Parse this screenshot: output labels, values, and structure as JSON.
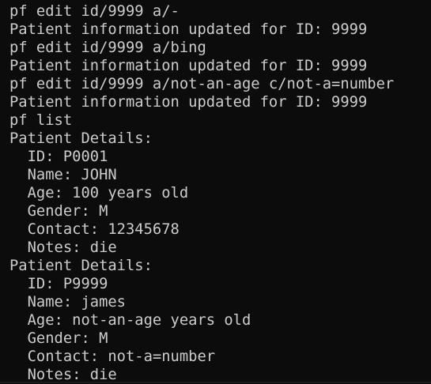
{
  "terminal": {
    "lines": [
      "pf edit id/9999 a/-",
      "Patient information updated for ID: 9999",
      "pf edit id/9999 a/bing",
      "Patient information updated for ID: 9999",
      "pf edit id/9999 a/not-an-age c/not-a=number",
      "Patient information updated for ID: 9999",
      "pf list",
      "Patient Details:",
      "  ID: P0001",
      "  Name: JOHN",
      "  Age: 100 years old",
      "  Gender: M",
      "  Contact: 12345678",
      "  Notes: die",
      "Patient Details:",
      "  ID: P9999",
      "  Name: james",
      "  Age: not-an-age years old",
      "  Gender: M",
      "  Contact: not-a=number",
      "  Notes: die"
    ]
  }
}
